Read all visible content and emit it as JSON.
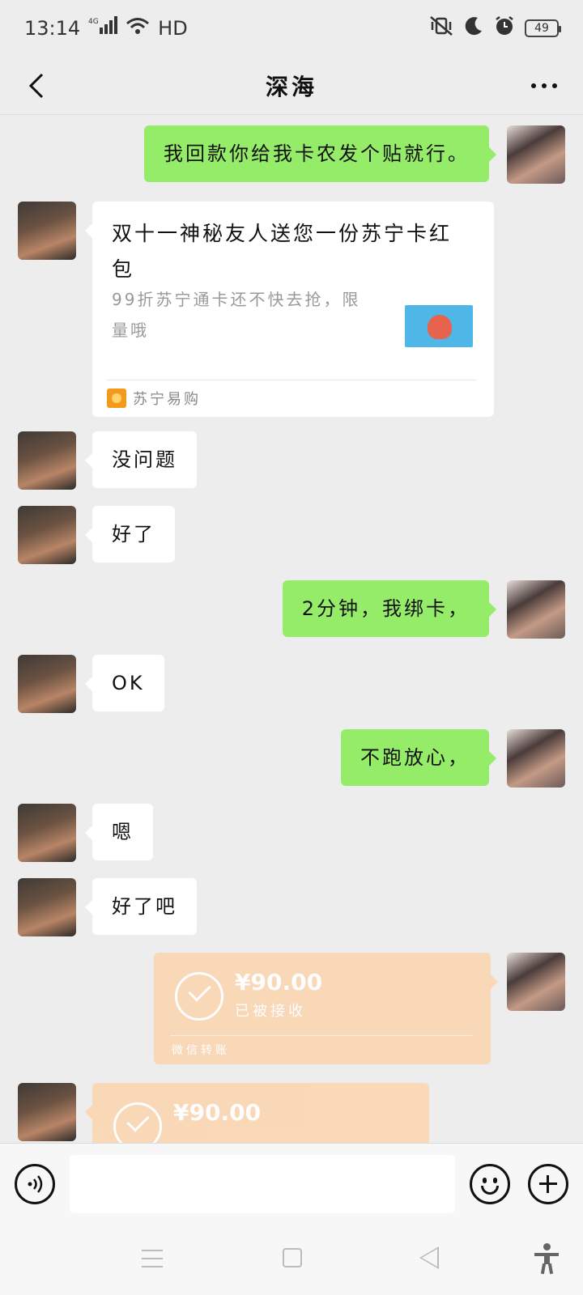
{
  "status_bar": {
    "time": "13:14",
    "network": "4G",
    "network_quality": "HD",
    "battery": "49"
  },
  "header": {
    "title": "深海"
  },
  "messages": [
    {
      "from": "me",
      "text": "我回款你给我卡农发个贴就行。"
    },
    {
      "from": "peer",
      "type": "link_card",
      "title": "双十一神秘友人送您一份苏宁卡红包",
      "description": "99折苏宁通卡还不快去抢，限量哦",
      "source": "苏宁易购"
    },
    {
      "from": "peer",
      "text": "没问题"
    },
    {
      "from": "peer",
      "text": "好了"
    },
    {
      "from": "me",
      "text": "2分钟，我绑卡，"
    },
    {
      "from": "peer",
      "text": "OK"
    },
    {
      "from": "me",
      "text": "不跑放心，"
    },
    {
      "from": "peer",
      "text": "嗯"
    },
    {
      "from": "peer",
      "text": "好了吧"
    },
    {
      "from": "me",
      "type": "transfer",
      "amount": "¥90.00",
      "status": "已被接收",
      "footer": "微信转账"
    },
    {
      "from": "peer",
      "type": "transfer",
      "amount": "¥90.00"
    }
  ],
  "input": {
    "value": ""
  },
  "colors": {
    "background": "#ededed",
    "my_bubble": "#95ec69",
    "peer_bubble": "#ffffff",
    "transfer": "#fbd6b3"
  }
}
